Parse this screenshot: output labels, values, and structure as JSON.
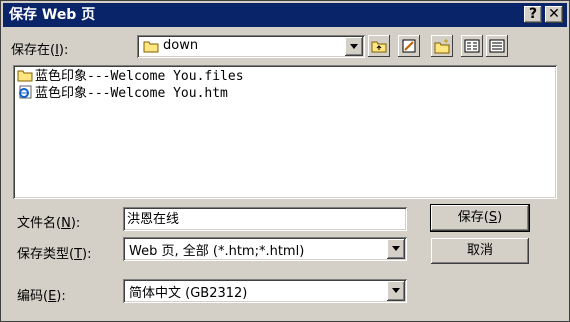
{
  "window": {
    "title": "保存 Web 页",
    "help_label": "?",
    "close_label": "✕"
  },
  "save_in": {
    "label_prefix": "保存在(",
    "accel": "I",
    "label_suffix": "):",
    "value": "down"
  },
  "toolbar": {
    "icons": [
      "up-folder-icon",
      "desktop-icon",
      "new-folder-icon",
      "list-view-icon",
      "details-view-icon"
    ]
  },
  "files": [
    {
      "name": "蓝色印象---Welcome You.files",
      "icon": "folder-icon"
    },
    {
      "name": "蓝色印象---Welcome You.htm",
      "icon": "ie-document-icon"
    }
  ],
  "filename": {
    "label_prefix": "文件名(",
    "accel": "N",
    "label_suffix": "):",
    "value": "洪恩在线"
  },
  "filetype": {
    "label_prefix": "保存类型(",
    "accel": "T",
    "label_suffix": "):",
    "value": "Web 页, 全部 (*.htm;*.html)"
  },
  "encoding": {
    "label_prefix": "编码(",
    "accel": "E",
    "label_suffix": "):",
    "value": "简体中文 (GB2312)"
  },
  "buttons": {
    "save_prefix": "保存(",
    "save_accel": "S",
    "save_suffix": ")",
    "cancel": "取消"
  },
  "colors": {
    "titlebar": "#0a246a",
    "face": "#d4d0c8"
  }
}
